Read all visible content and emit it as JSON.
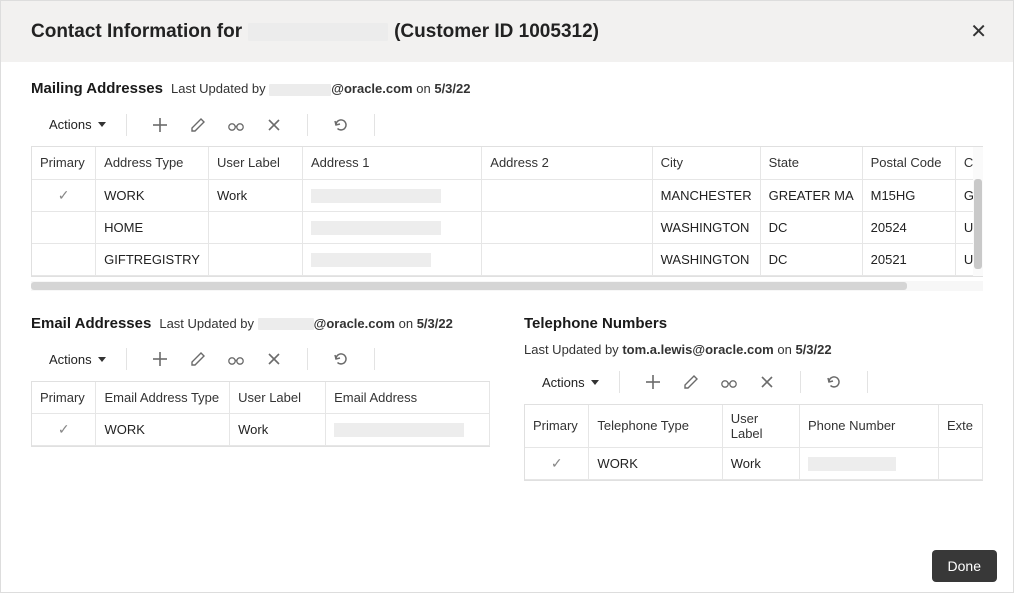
{
  "dialog": {
    "title_prefix": "Contact Information for",
    "customer_name": "[redacted]",
    "title_suffix": "(Customer ID 1005312)",
    "close_label": "✕"
  },
  "mailing": {
    "title": "Mailing Addresses",
    "meta_prefix": "Last Updated by",
    "meta_user": "[redacted]",
    "meta_domain": "@oracle.com",
    "meta_on": "on",
    "meta_date": "5/3/22",
    "actions_label": "Actions",
    "columns": [
      "Primary",
      "Address Type",
      "User Label",
      "Address 1",
      "Address 2",
      "City",
      "State",
      "Postal Code",
      "C"
    ],
    "rows": [
      {
        "primary": true,
        "type": "WORK",
        "user_label": "Work",
        "addr1": "[redacted]",
        "addr2": "",
        "city": "MANCHESTER",
        "state": "GREATER MA",
        "postal": "M15HG",
        "c": "G"
      },
      {
        "primary": false,
        "type": "HOME",
        "user_label": "",
        "addr1": "[redacted]",
        "addr2": "",
        "city": "WASHINGTON",
        "state": "DC",
        "postal": "20524",
        "c": "U"
      },
      {
        "primary": false,
        "type": "GIFTREGISTRY",
        "user_label": "",
        "addr1": "[redacted]",
        "addr2": "",
        "city": "WASHINGTON",
        "state": "DC",
        "postal": "20521",
        "c": "U"
      }
    ]
  },
  "email": {
    "title": "Email Addresses",
    "meta_prefix": "Last Updated by",
    "meta_user": "[redacted]",
    "meta_domain": "@oracle.com",
    "meta_on": "on",
    "meta_date": "5/3/22",
    "actions_label": "Actions",
    "columns": [
      "Primary",
      "Email Address Type",
      "User Label",
      "Email Address"
    ],
    "rows": [
      {
        "primary": true,
        "type": "WORK",
        "user_label": "Work",
        "address": "[redacted]"
      }
    ]
  },
  "phone": {
    "title": "Telephone Numbers",
    "meta_prefix": "Last Updated by",
    "meta_user": "tom.a.lewis@oracle.com",
    "meta_on": "on",
    "meta_date": "5/3/22",
    "actions_label": "Actions",
    "columns": [
      "Primary",
      "Telephone Type",
      "User Label",
      "Phone Number",
      "Exte"
    ],
    "rows": [
      {
        "primary": true,
        "type": "WORK",
        "user_label": "Work",
        "number": "[redacted]",
        "ext": ""
      }
    ]
  },
  "footer": {
    "done": "Done"
  }
}
